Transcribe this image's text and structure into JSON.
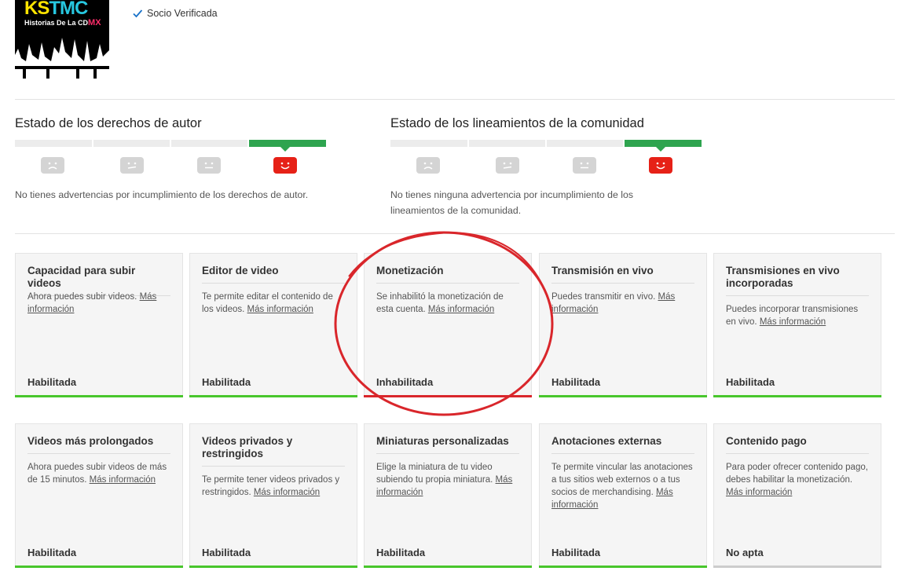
{
  "header": {
    "logo_ks": "KS",
    "logo_tmc": "TMC",
    "logo_subtitle": "Historias De La CD",
    "logo_mx": "MX",
    "verified_label": "Socio Verificada"
  },
  "copyright": {
    "title": "Estado de los derechos de autor",
    "message": "No tienes advertencias por incumplimiento de los derechos de autor."
  },
  "community": {
    "title": "Estado de los lineamientos de la comunidad",
    "message": "No tienes ninguna advertencia por incumplimiento de los lineamientos de la comunidad."
  },
  "cards": [
    {
      "title": "Capacidad para subir videos",
      "desc": "Ahora puedes subir videos.",
      "link": "Más información",
      "state": "Habilitada"
    },
    {
      "title": "Editor de video",
      "desc": "Te permite editar el contenido de los videos.",
      "link": "Más información",
      "state": "Habilitada"
    },
    {
      "title": "Monetización",
      "desc": "Se inhabilitó la monetización de esta cuenta.",
      "link": "Más información",
      "state": "Inhabilitada"
    },
    {
      "title": "Transmisión en vivo",
      "desc": "Puedes transmitir en vivo.",
      "link": "Más información",
      "state": "Habilitada"
    },
    {
      "title": "Transmisiones en vivo incorporadas",
      "desc": "Puedes incorporar transmisiones en vivo.",
      "link": "Más información",
      "state": "Habilitada"
    },
    {
      "title": "Videos más prolongados",
      "desc": "Ahora puedes subir videos de más de 15 minutos.",
      "link": "Más información",
      "state": "Habilitada"
    },
    {
      "title": "Videos privados y restringidos",
      "desc": "Te permite tener videos privados y restringidos.",
      "link": "Más información",
      "state": "Habilitada"
    },
    {
      "title": "Miniaturas personalizadas",
      "desc": "Elige la miniatura de tu video subiendo tu propia miniatura.",
      "link": "Más información",
      "state": "Habilitada"
    },
    {
      "title": "Anotaciones externas",
      "desc": "Te permite vincular las anotaciones a tus sitios web externos o a tus socios de merchandising.",
      "link": "Más información",
      "state": "Habilitada"
    },
    {
      "title": "Contenido pago",
      "desc": "Para poder ofrecer contenido pago, debes habilitar la monetización.",
      "link": "Más información",
      "state": "No apta"
    }
  ],
  "colors": {
    "enabled_bar": "#48c62c",
    "disabled_bar": "#d9262b",
    "ineligible_bar": "#cccccc",
    "status_good": "#2ea44f",
    "annotation_circle": "#d9262b"
  }
}
